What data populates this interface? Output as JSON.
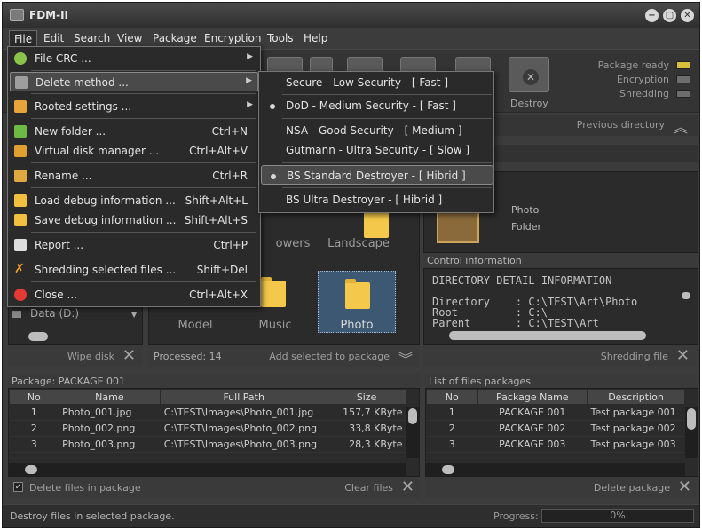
{
  "window": {
    "title": "FDM-II",
    "minimize": "−",
    "maximize": "▢",
    "close": "✕"
  },
  "menubar": [
    "File",
    "Edit",
    "Search",
    "View",
    "Package",
    "Encryption",
    "Tools",
    "Help"
  ],
  "toolbar": {
    "destroy_label": "Destroy",
    "indicators": [
      {
        "label": "Package ready",
        "color": "#d9c03a"
      },
      {
        "label": "Encryption",
        "color": "#6d6d6d"
      },
      {
        "label": "Shredding",
        "color": "#6d6d6d"
      }
    ]
  },
  "nav": {
    "previous_directory": "Previous directory"
  },
  "drives": {
    "data_drive": "Data (D:)",
    "wipe_disk": "Wipe disk"
  },
  "thumbnails": {
    "items": [
      "owers",
      "Landscape",
      "Model",
      "Music",
      "Photo"
    ],
    "processed": "Processed: 14",
    "add_to_package": "Add selected to package"
  },
  "preview": {
    "name": "Photo",
    "type": "Folder"
  },
  "control_info": {
    "header": "Control information",
    "lines": [
      "DIRECTORY DETAIL INFORMATION",
      "",
      "Directory    : C:\\TEST\\Art\\Photo",
      "Root         : C:\\",
      "Parent       : C:\\TEST\\Art"
    ],
    "shredding_file": "Shredding file"
  },
  "package": {
    "header": "Package: PACKAGE 001",
    "columns": [
      "No",
      "Name",
      "Full Path",
      "Size"
    ],
    "rows": [
      [
        "1",
        "Photo_001.jpg",
        "C:\\TEST\\Images\\Photo_001.jpg",
        "157,7 KByte"
      ],
      [
        "2",
        "Photo_002.png",
        "C:\\TEST\\Images\\Photo_002.png",
        "33,8 KByte"
      ],
      [
        "3",
        "Photo_003.png",
        "C:\\TEST\\Images\\Photo_003.png",
        "28,3 KByte"
      ]
    ],
    "delete_files": "Delete files in package",
    "clear_files": "Clear files"
  },
  "packages_list": {
    "header": "List of files packages",
    "columns": [
      "No",
      "Package Name",
      "Description"
    ],
    "rows": [
      [
        "1",
        "PACKAGE 001",
        "Test package 001"
      ],
      [
        "2",
        "PACKAGE 002",
        "Test package 002"
      ],
      [
        "3",
        "PACKAGE 003",
        "Test package 003"
      ]
    ],
    "delete_package": "Delete package"
  },
  "status": {
    "message": "Destroy files in selected package.",
    "progress_label": "Progress:",
    "progress_value": "0%"
  },
  "file_menu": [
    {
      "label": "File CRC ...",
      "shortcut": "",
      "submenu": true,
      "icon": "gear-icon",
      "color": "#8bc34a"
    },
    {
      "label": "Delete method ...",
      "shortcut": "",
      "submenu": true,
      "icon": "trash-icon",
      "color": "#9e9e9e"
    },
    {
      "label": "Rooted settings ...",
      "shortcut": "",
      "submenu": true,
      "icon": "settings-icon",
      "color": "#e8a33a"
    },
    {
      "label": "New folder ...",
      "shortcut": "Ctrl+N",
      "submenu": false,
      "icon": "new-folder-icon",
      "color": "#6dbb45"
    },
    {
      "label": "Virtual disk manager ...",
      "shortcut": "Ctrl+Alt+V",
      "submenu": false,
      "icon": "disk-icon",
      "color": "#e0a030"
    },
    {
      "label": "Rename ...",
      "shortcut": "Ctrl+R",
      "submenu": false,
      "icon": "rename-icon",
      "color": "#e2a840"
    },
    {
      "label": "Load debug information ...",
      "shortcut": "Shift+Alt+L",
      "submenu": false,
      "icon": "load-icon",
      "color": "#f2c040"
    },
    {
      "label": "Save debug information ...",
      "shortcut": "Shift+Alt+S",
      "submenu": false,
      "icon": "save-icon",
      "color": "#f2c040"
    },
    {
      "label": "Report ...",
      "shortcut": "Ctrl+P",
      "submenu": false,
      "icon": "printer-icon",
      "color": "#dddddd"
    },
    {
      "label": "Shredding selected files ...",
      "shortcut": "Shift+Del",
      "submenu": false,
      "icon": "shred-icon",
      "color": "#f0a020"
    },
    {
      "label": "Close ...",
      "shortcut": "Ctrl+Alt+X",
      "submenu": false,
      "icon": "power-icon",
      "color": "#e53935"
    }
  ],
  "delete_methods": [
    {
      "label": "Secure - Low Security - [ Fast ]",
      "selected": false
    },
    {
      "label": "DoD - Medium Security - [ Fast ]",
      "selected": true
    },
    {
      "label": "NSA - Good Security - [ Medium ]",
      "selected": false
    },
    {
      "label": "Gutmann - Ultra Security - [ Slow ]",
      "selected": false
    },
    {
      "label": "BS Standard Destroyer - [ Hibrid ]",
      "selected": true
    },
    {
      "label": "BS Ultra Destroyer - [ Hibrid ]",
      "selected": false
    }
  ]
}
